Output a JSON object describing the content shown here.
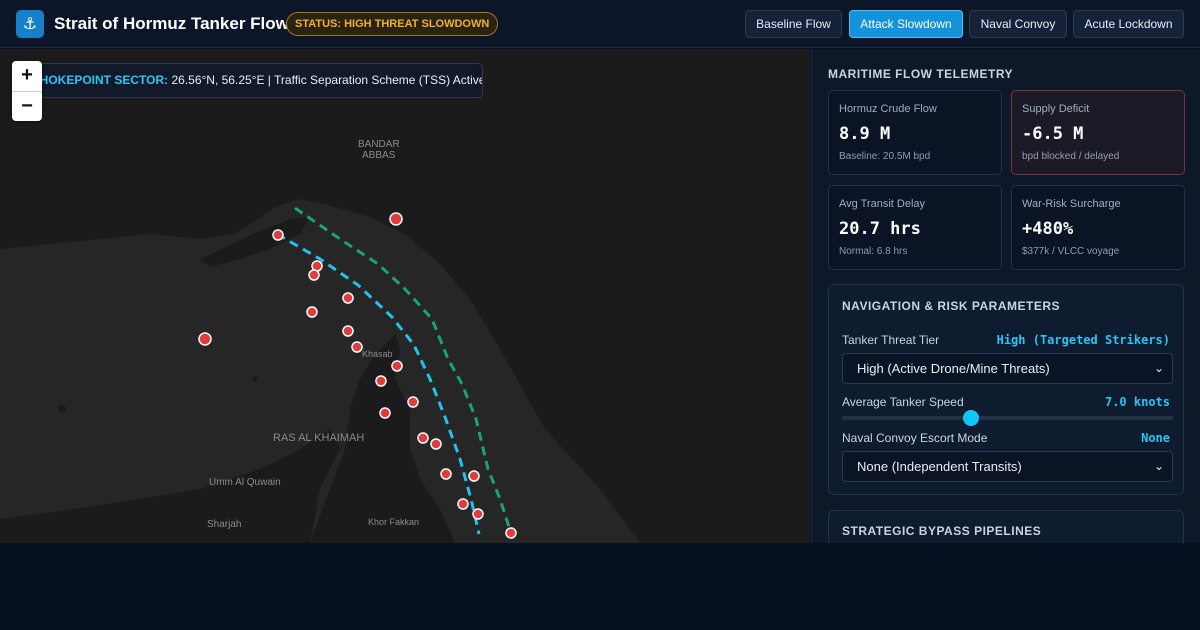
{
  "header": {
    "logo_icon": "anchor-icon",
    "logo_glyph": "⚓",
    "title": "Strait of Hormuz Tanker Flow",
    "status": "STATUS: HIGH THREAT SLOWDOWN",
    "scenarios": [
      "Baseline Flow",
      "Attack Slowdown",
      "Naval Convoy",
      "Acute Lockdown"
    ],
    "active_scenario": "Attack Slowdown"
  },
  "map": {
    "zoom_in": "+",
    "zoom_out": "−",
    "sector_label": "CHOKEPOINT SECTOR:",
    "sector_text": "26.56°N, 56.25°E | Traffic Separation Scheme (TSS) Active",
    "places": [
      "BANDAR",
      "ABBAS",
      "RAS AL KHAIMAH",
      "Umm Al Quwain",
      "Sharjah",
      "Khor Fakkan",
      "Khasab"
    ],
    "colors": {
      "inbound_lane": "#1fc2f0",
      "outbound_lane": "#1aa37a",
      "threat_marker": "#e03c3c"
    }
  },
  "sidebar": {
    "telemetry_title": "MARITIME FLOW TELEMETRY",
    "cards": [
      {
        "label": "Hormuz Crude Flow",
        "value": "8.9 M",
        "sub": "Baseline: 20.5M bpd"
      },
      {
        "label": "Supply Deficit",
        "value": "-6.5 M",
        "sub": "bpd blocked / delayed"
      },
      {
        "label": "Avg Transit Delay",
        "value": "20.7 hrs",
        "sub": "Normal: 6.8 hrs"
      },
      {
        "label": "War-Risk Surcharge",
        "value": "+480%",
        "sub": "$377k / VLCC voyage"
      }
    ],
    "params": {
      "title": "NAVIGATION & RISK PARAMETERS",
      "threat_label": "Tanker Threat Tier",
      "threat_value": "High (Targeted Strikers)",
      "threat_select": "High (Active Drone/Mine Threats)",
      "speed_label": "Average Tanker Speed",
      "speed_value": "7.0 knots",
      "speed_fraction": 0.39,
      "escort_label": "Naval Convoy Escort Mode",
      "escort_value": "None",
      "escort_select": "None (Independent Transits)"
    },
    "bypass_title": "STRATEGIC BYPASS PIPELINES"
  }
}
